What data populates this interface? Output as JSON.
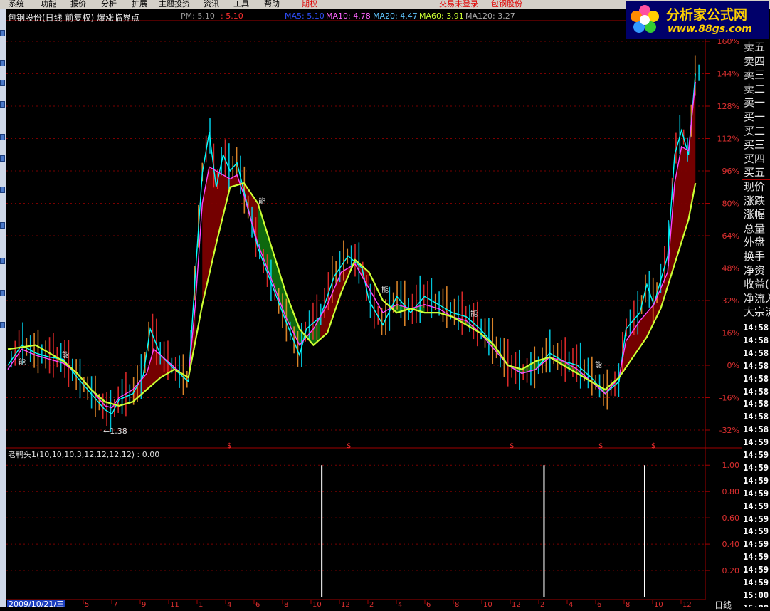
{
  "menu": {
    "items": [
      "系统",
      "功能",
      "报价",
      "分析",
      "扩展",
      "主题投资",
      "资讯",
      "工具",
      "帮助"
    ],
    "highlight": "期权",
    "login_status": "交易未登录",
    "stock_link": "包钢股份"
  },
  "header": {
    "title": "包钢股份(日线 前复权) 爆涨临界点",
    "pm_label": "PM: 5.10",
    "pm_value": ": 5.10",
    "ma5": "MA5: 5.10",
    "ma10": "MA10: 4.78",
    "ma20": "MA20: 4.47",
    "ma60": "MA60: 3.91",
    "ma120": "MA120: 3.27"
  },
  "logo": {
    "title": "分析家公式网",
    "url": "www.88gs.com"
  },
  "main_axis": {
    "tick_labels": [
      "160%",
      "144%",
      "128%",
      "112%",
      "96%",
      "80%",
      "64%",
      "48%",
      "32%",
      "16%",
      "0%",
      "-16%",
      "-32%"
    ],
    "tick_values": [
      160,
      144,
      128,
      112,
      96,
      80,
      64,
      48,
      32,
      16,
      0,
      -16,
      -32
    ]
  },
  "sub_axis": {
    "tick_labels": [
      "1.00",
      "0.80",
      "0.60",
      "0.40",
      "0.20"
    ],
    "tick_values": [
      1.0,
      0.8,
      0.6,
      0.4,
      0.2
    ]
  },
  "indicator": {
    "label": "老鸭头1(10,10,10,3,12,12,12,12) : 0.00"
  },
  "annotations": {
    "low_price": "←1.38",
    "energy_marks": [
      "能",
      "能",
      "能",
      "能",
      "能",
      "能"
    ],
    "dollar_marks": [
      "$",
      "$",
      "$",
      "$",
      "$"
    ]
  },
  "x_axis": {
    "start_date": "2009/10/21/三",
    "months": [
      "5",
      "7",
      "9",
      "11",
      "1",
      "4",
      "6",
      "8",
      "10",
      "12",
      "2",
      "4",
      "6",
      "8",
      "10",
      "12",
      "2",
      "4",
      "6",
      "8",
      "10",
      "12"
    ],
    "period": "日线"
  },
  "right_panel": {
    "labels": [
      "卖五",
      "卖四",
      "卖三",
      "卖二",
      "卖一",
      "买一",
      "买二",
      "买三",
      "买四",
      "买五",
      "现价",
      "涨跌",
      "涨幅",
      "总量",
      "外盘",
      "换手",
      "净资",
      "收益(",
      "净流入",
      "大宗流"
    ],
    "times": [
      "14:58",
      "14:58",
      "14:58",
      "14:58",
      "14:58",
      "14:58",
      "14:58",
      "14:58",
      "14:58",
      "14:59",
      "14:59",
      "14:59",
      "14:59",
      "14:59",
      "14:59",
      "14:59",
      "14:59",
      "14:59",
      "14:59",
      "14:59",
      "14:59",
      "15:00",
      "15:00"
    ]
  },
  "chart_data": {
    "type": "line",
    "title": "包钢股份(日线 前复权) 爆涨临界点",
    "ylabel": "",
    "ylim": [
      -40,
      165
    ],
    "x_range": [
      0,
      100
    ],
    "series": [
      {
        "name": "MA5",
        "color": "#00ffff",
        "points": [
          [
            0,
            0
          ],
          [
            2,
            10
          ],
          [
            4,
            6
          ],
          [
            6,
            4
          ],
          [
            8,
            3
          ],
          [
            10,
            -6
          ],
          [
            12,
            -14
          ],
          [
            14,
            -22
          ],
          [
            15,
            -24
          ],
          [
            16,
            -17
          ],
          [
            18,
            -14
          ],
          [
            19.5,
            -5
          ],
          [
            20.5,
            18
          ],
          [
            22,
            5
          ],
          [
            24,
            -2
          ],
          [
            26,
            -8
          ],
          [
            27,
            45
          ],
          [
            28,
            95
          ],
          [
            29,
            115
          ],
          [
            30,
            88
          ],
          [
            31,
            104
          ],
          [
            32,
            96
          ],
          [
            33,
            100
          ],
          [
            34,
            86
          ],
          [
            35,
            72
          ],
          [
            36,
            58
          ],
          [
            38,
            40
          ],
          [
            40,
            22
          ],
          [
            42,
            5
          ],
          [
            43,
            18
          ],
          [
            45,
            24
          ],
          [
            47,
            44
          ],
          [
            49,
            54
          ],
          [
            51,
            48
          ],
          [
            52,
            32
          ],
          [
            54,
            20
          ],
          [
            56,
            34
          ],
          [
            58,
            26
          ],
          [
            60,
            34
          ],
          [
            62,
            30
          ],
          [
            64,
            26
          ],
          [
            66,
            24
          ],
          [
            68,
            18
          ],
          [
            70,
            10
          ],
          [
            72,
            0
          ],
          [
            74,
            -4
          ],
          [
            76,
            -2
          ],
          [
            78,
            6
          ],
          [
            80,
            2
          ],
          [
            82,
            0
          ],
          [
            84,
            -6
          ],
          [
            86,
            -14
          ],
          [
            88,
            -8
          ],
          [
            89,
            18
          ],
          [
            91,
            26
          ],
          [
            92,
            40
          ],
          [
            93,
            30
          ],
          [
            95,
            54
          ],
          [
            96,
            104
          ],
          [
            97,
            116
          ],
          [
            98,
            104
          ],
          [
            99,
            144
          ]
        ]
      },
      {
        "name": "MA10",
        "color": "#ff44ff",
        "points": [
          [
            0,
            -2
          ],
          [
            2,
            8
          ],
          [
            4,
            5
          ],
          [
            6,
            3
          ],
          [
            8,
            1
          ],
          [
            10,
            -4
          ],
          [
            12,
            -12
          ],
          [
            14,
            -20
          ],
          [
            15,
            -21
          ],
          [
            16,
            -16
          ],
          [
            18,
            -12
          ],
          [
            20,
            -4
          ],
          [
            21,
            8
          ],
          [
            23,
            2
          ],
          [
            25,
            -4
          ],
          [
            26,
            -6
          ],
          [
            27,
            30
          ],
          [
            28,
            80
          ],
          [
            29,
            98
          ],
          [
            31,
            94
          ],
          [
            32,
            92
          ],
          [
            33,
            94
          ],
          [
            34,
            84
          ],
          [
            36,
            60
          ],
          [
            38,
            42
          ],
          [
            40,
            24
          ],
          [
            42,
            10
          ],
          [
            44,
            18
          ],
          [
            46,
            30
          ],
          [
            48,
            46
          ],
          [
            50,
            50
          ],
          [
            52,
            38
          ],
          [
            54,
            26
          ],
          [
            56,
            30
          ],
          [
            58,
            28
          ],
          [
            60,
            30
          ],
          [
            62,
            28
          ],
          [
            64,
            24
          ],
          [
            66,
            22
          ],
          [
            68,
            16
          ],
          [
            70,
            8
          ],
          [
            72,
            0
          ],
          [
            74,
            -4
          ],
          [
            76,
            -2
          ],
          [
            78,
            4
          ],
          [
            80,
            2
          ],
          [
            82,
            -2
          ],
          [
            84,
            -8
          ],
          [
            86,
            -14
          ],
          [
            88,
            -6
          ],
          [
            89,
            12
          ],
          [
            91,
            22
          ],
          [
            93,
            30
          ],
          [
            95,
            46
          ],
          [
            96,
            90
          ],
          [
            97,
            108
          ],
          [
            98,
            106
          ],
          [
            99,
            140
          ]
        ]
      },
      {
        "name": "MA60",
        "color": "#ccff33",
        "points": [
          [
            0,
            8
          ],
          [
            4,
            10
          ],
          [
            8,
            2
          ],
          [
            10,
            -4
          ],
          [
            12,
            -12
          ],
          [
            14,
            -18
          ],
          [
            16,
            -20
          ],
          [
            18,
            -18
          ],
          [
            20,
            -12
          ],
          [
            22,
            -6
          ],
          [
            24,
            -2
          ],
          [
            26,
            -6
          ],
          [
            28,
            30
          ],
          [
            30,
            60
          ],
          [
            32,
            88
          ],
          [
            34,
            90
          ],
          [
            36,
            80
          ],
          [
            38,
            58
          ],
          [
            40,
            36
          ],
          [
            42,
            18
          ],
          [
            44,
            10
          ],
          [
            46,
            16
          ],
          [
            48,
            36
          ],
          [
            50,
            52
          ],
          [
            52,
            46
          ],
          [
            54,
            32
          ],
          [
            56,
            26
          ],
          [
            58,
            28
          ],
          [
            60,
            26
          ],
          [
            62,
            26
          ],
          [
            64,
            24
          ],
          [
            66,
            20
          ],
          [
            68,
            16
          ],
          [
            70,
            10
          ],
          [
            72,
            0
          ],
          [
            74,
            -2
          ],
          [
            76,
            2
          ],
          [
            78,
            4
          ],
          [
            80,
            0
          ],
          [
            82,
            -4
          ],
          [
            84,
            -8
          ],
          [
            86,
            -12
          ],
          [
            88,
            -6
          ],
          [
            90,
            4
          ],
          [
            92,
            14
          ],
          [
            94,
            28
          ],
          [
            96,
            50
          ],
          [
            98,
            72
          ],
          [
            99,
            90
          ]
        ]
      }
    ],
    "fill_bands": [
      {
        "color": "#0f6e0f",
        "x_range": [
          7,
          14
        ]
      },
      {
        "color": "#0f6e0f",
        "x_range": [
          35,
          45
        ]
      },
      {
        "color": "#0f6e0f",
        "x_range": [
          55,
          60
        ]
      },
      {
        "color": "#0f6e0f",
        "x_range": [
          64,
          86
        ]
      },
      {
        "color": "#7a0000",
        "x_range": [
          18,
          27
        ]
      },
      {
        "color": "#7a0000",
        "x_range": [
          28,
          36
        ]
      },
      {
        "color": "#7a0000",
        "x_range": [
          45,
          52
        ]
      },
      {
        "color": "#7a0000",
        "x_range": [
          87,
          99
        ]
      }
    ],
    "sub_chart": {
      "name": "老鸭头1",
      "type": "bar",
      "ylim": [
        0,
        1.05
      ],
      "spikes": [
        {
          "x": 45.2,
          "value": 1.0
        },
        {
          "x": 77.2,
          "value": 1.0
        },
        {
          "x": 91.7,
          "value": 1.0
        }
      ]
    }
  }
}
